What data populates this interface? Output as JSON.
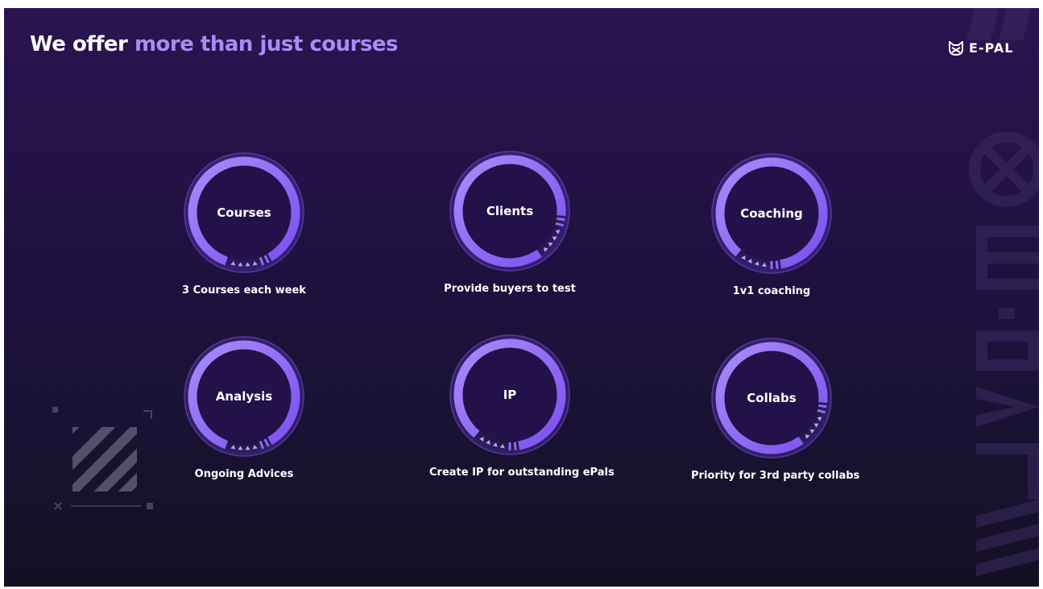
{
  "title": {
    "lead": "We offer",
    "accent": "more than just courses"
  },
  "logo": {
    "text": "E-PAL",
    "icon": "cat-mask-icon"
  },
  "colors": {
    "background": "#1e1140",
    "accent": "#a98cf5",
    "ring": "#7b4ff0",
    "ring_light": "#a88cf8"
  },
  "offers": [
    {
      "label": "Courses",
      "caption": "3 Courses each week"
    },
    {
      "label": "Clients",
      "caption": "Provide buyers to test"
    },
    {
      "label": "Coaching",
      "caption": "1v1 coaching"
    },
    {
      "label": "Analysis",
      "caption": "Ongoing Advices"
    },
    {
      "label": "IP",
      "caption": "Create IP for outstanding ePals"
    },
    {
      "label": "Collabs",
      "caption": "Priority for 3rd party collabs"
    }
  ]
}
